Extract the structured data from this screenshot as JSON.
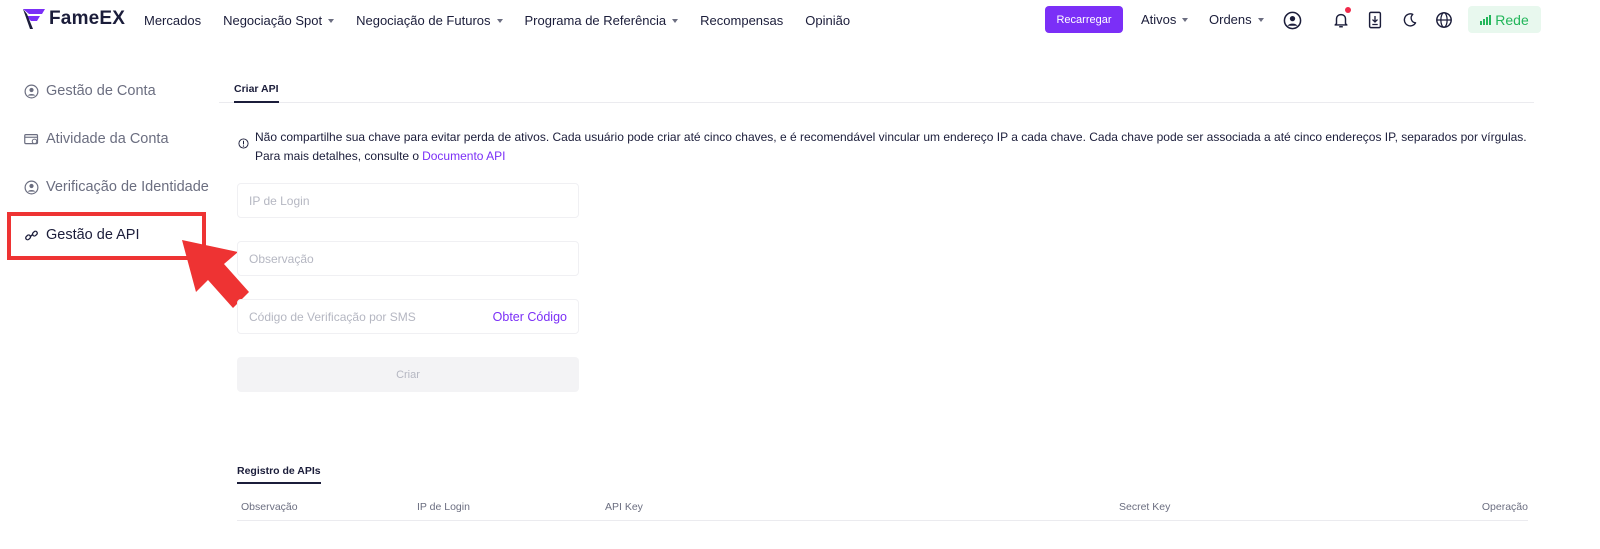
{
  "brand": {
    "name": "FameEX",
    "accent": "#7b2ff7",
    "success": "#22b65a",
    "alert": "#f0294a",
    "highlight": "#ee3333"
  },
  "nav": {
    "items": [
      {
        "label": "Mercados",
        "dropdown": false
      },
      {
        "label": "Negociação Spot",
        "dropdown": true
      },
      {
        "label": "Negociação de Futuros",
        "dropdown": true
      },
      {
        "label": "Programa de Referência",
        "dropdown": true
      },
      {
        "label": "Recompensas",
        "dropdown": false
      },
      {
        "label": "Opinião",
        "dropdown": false
      }
    ]
  },
  "header": {
    "recharge_label": "Recarregar",
    "assets_label": "Ativos",
    "orders_label": "Ordens",
    "network_label": "Rede",
    "icons": [
      "user-circle-icon",
      "bell-icon",
      "download-icon",
      "moon-icon",
      "globe-icon"
    ]
  },
  "sidebar": {
    "items": [
      {
        "label": "Gestão de Conta",
        "icon": "user-circle-icon",
        "active": false
      },
      {
        "label": "Atividade da Conta",
        "icon": "activity-card-icon",
        "active": false
      },
      {
        "label": "Verificação de Identidade",
        "icon": "identity-icon",
        "active": false
      },
      {
        "label": "Gestão de API",
        "icon": "link-icon",
        "active": true
      }
    ]
  },
  "main": {
    "tab_label": "Criar API",
    "notice_text": "Não compartilhe sua chave para evitar perda de ativos. Cada usuário pode criar até cinco chaves, e é recomendável vincular um endereço IP a cada chave. Cada chave pode ser associada a até cinco endereços IP, separados por vírgulas. Para mais detalhes, consulte o",
    "notice_link": "Documento API",
    "form": {
      "login_ip_placeholder": "IP de Login",
      "note_placeholder": "Observação",
      "sms_code_placeholder": "Código de Verificação por SMS",
      "get_code_label": "Obter Código",
      "create_label": "Criar"
    },
    "records": {
      "title": "Registro de APIs",
      "columns": [
        "Observação",
        "IP de Login",
        "API Key",
        "Secret Key",
        "Operação"
      ]
    }
  }
}
